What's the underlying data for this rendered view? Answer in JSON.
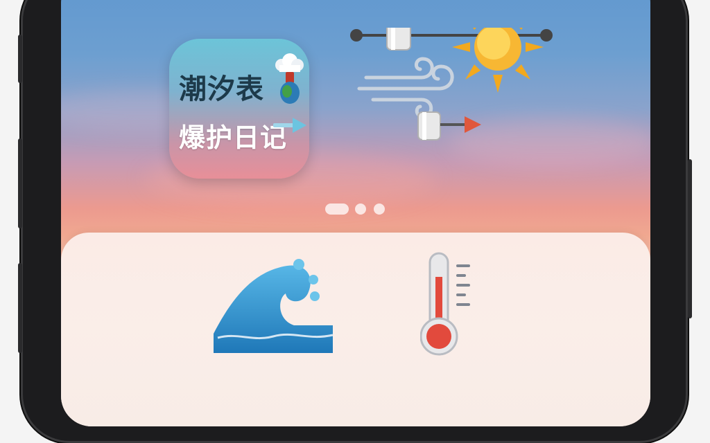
{
  "app": {
    "title_line1": "潮汐表",
    "title_line2": "爆护日记"
  },
  "page_indicator": {
    "count": 3,
    "active": 0
  },
  "icons": {
    "app_icon": "tide-app-icon",
    "pinwheel": "tide-gauge-icon",
    "sun": "sun-icon",
    "wind": "wind-icon",
    "wave": "wave-icon",
    "thermometer": "thermometer-icon"
  },
  "colors": {
    "sky_top": "#5f97cf",
    "sky_sunset": "#ec9a8f",
    "panel": "#f8ece6",
    "wave_blue": "#2f8fcf",
    "thermo_red": "#e24a3d"
  }
}
